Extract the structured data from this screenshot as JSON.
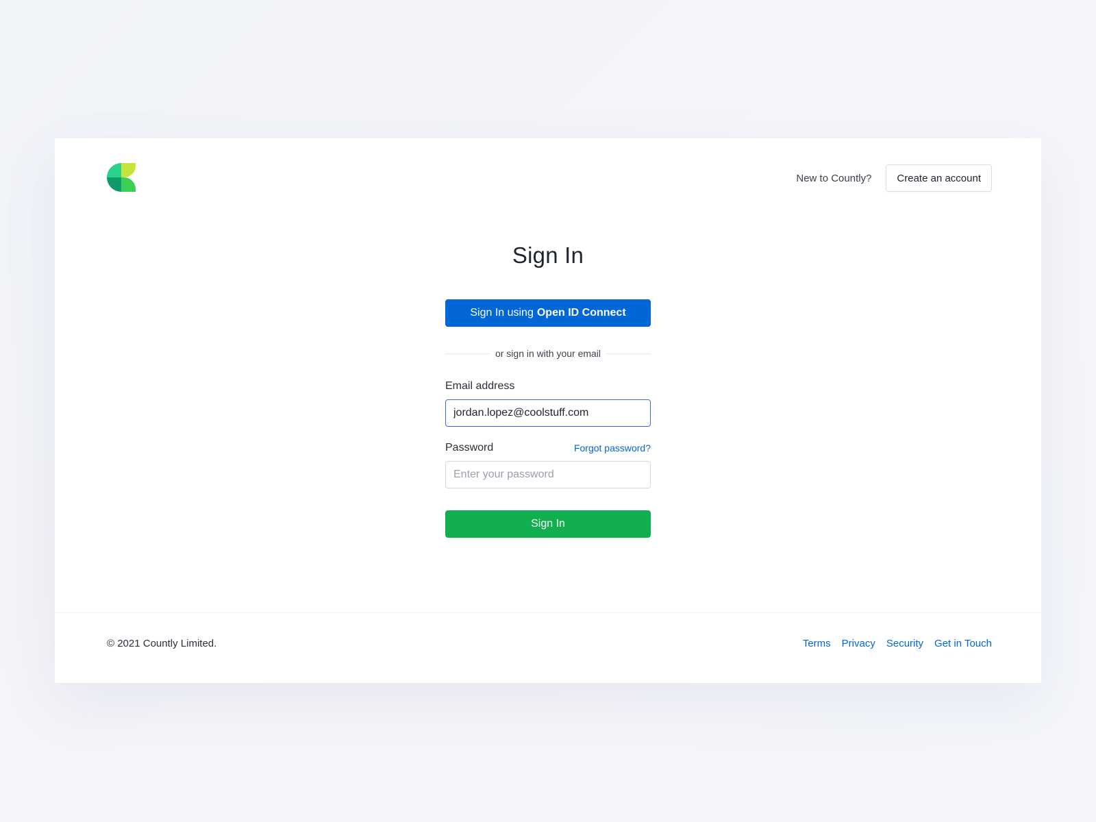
{
  "header": {
    "logo_icon": "countly-logo-icon",
    "new_prompt": "New to Countly?",
    "create_account_label": "Create an account"
  },
  "form": {
    "title": "Sign In",
    "oidc_prefix": "Sign In using",
    "oidc_provider": "Open ID Connect",
    "divider_text": "or sign in with your email",
    "email_label": "Email address",
    "email_value": "jordan.lopez@coolstuff.com",
    "password_label": "Password",
    "forgot_label": "Forgot password?",
    "password_placeholder": "Enter your password",
    "submit_label": "Sign In"
  },
  "footer": {
    "copyright": "© 2021 Countly Limited.",
    "links": [
      "Terms",
      "Privacy",
      "Security",
      "Get in Touch"
    ]
  },
  "colors": {
    "primary_blue": "#0166d6",
    "signin_green": "#12af51",
    "logo_green_light": "#c6e33a",
    "logo_green_teal": "#1fcf8a",
    "logo_green_dark": "#0f9a6a"
  }
}
